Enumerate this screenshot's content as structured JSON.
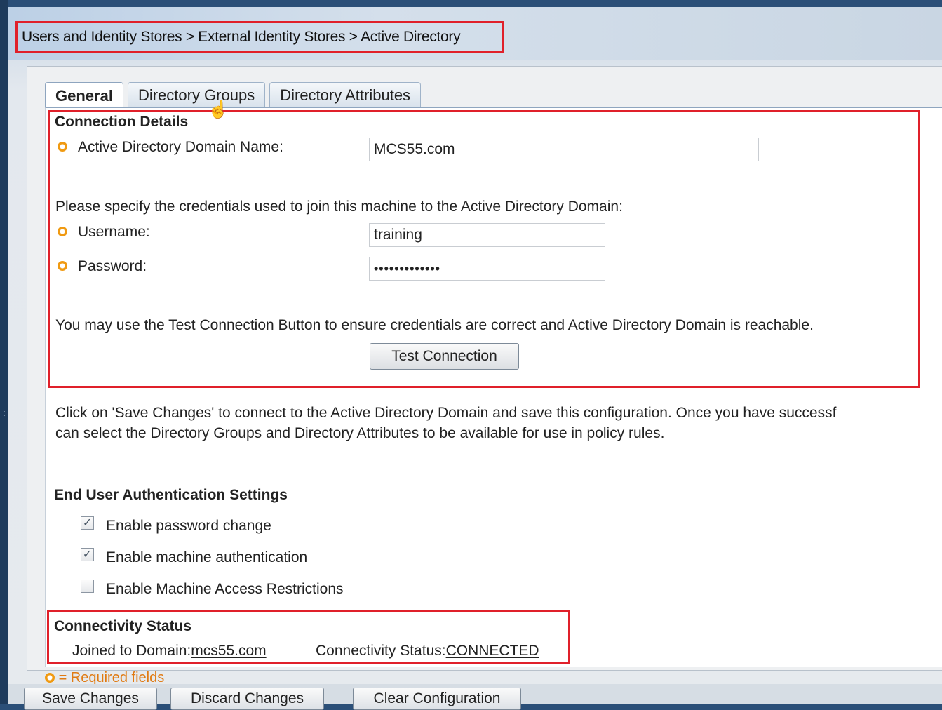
{
  "breadcrumb": "Users and Identity Stores > External Identity Stores > Active Directory",
  "tabs": [
    "General",
    "Directory Groups",
    "Directory Attributes"
  ],
  "connection": {
    "heading": "Connection Details",
    "domain_label": "Active Directory Domain Name:",
    "domain_value": "MCS55.com",
    "credentials_prompt": "Please specify the credentials used to join this machine to the Active Directory Domain:",
    "username_label": "Username:",
    "username_value": "training",
    "password_label": "Password:",
    "password_value": "•••••••••••••",
    "test_hint": "You may use the Test Connection Button to ensure credentials are correct and Active Directory Domain is reachable.",
    "test_button": "Test Connection"
  },
  "save_info": {
    "line1": "Click on 'Save Changes' to connect to the Active Directory Domain and save this configuration. Once you have successf",
    "line2": "can select the Directory Groups and Directory Attributes to be available for use in policy rules."
  },
  "auth_settings": {
    "heading": "End User Authentication Settings",
    "options": [
      {
        "label": "Enable password change",
        "checked": true
      },
      {
        "label": "Enable machine authentication",
        "checked": true
      },
      {
        "label": "Enable Machine Access Restrictions",
        "checked": false
      }
    ]
  },
  "status": {
    "heading": "Connectivity Status",
    "joined_label": "Joined to Domain:",
    "joined_value": "mcs55.com",
    "status_label": "Connectivity Status:",
    "status_value": "CONNECTED"
  },
  "required_legend": "= Required fields",
  "footer_buttons": [
    "Save Changes",
    "Discard Changes",
    "Clear Configuration"
  ],
  "colors": {
    "highlight_box": "#e0202a",
    "required_icon": "#f09a12"
  }
}
